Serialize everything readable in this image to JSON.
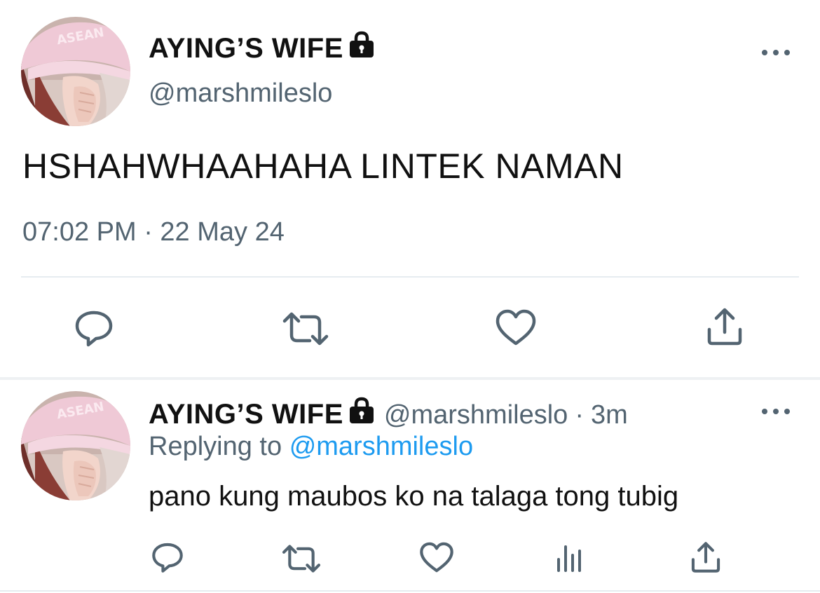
{
  "main_tweet": {
    "display_name": "AYING’S WIFE",
    "handle": "@marshmileslo",
    "text": "HSHAHWHAAHAHA LINTEK NAMAN",
    "timestamp": "07:02 PM · 22 May 24",
    "actions": [
      "reply-icon",
      "retweet-icon",
      "like-icon",
      "share-icon"
    ]
  },
  "reply_tweet": {
    "display_name": "AYING’S WIFE",
    "handle": "@marshmileslo",
    "separator": "·",
    "age": "3m",
    "replying_prefix": "Replying to",
    "replying_handle": "@marshmileslo",
    "text": "pano kung maubos ko na talaga tong tubig",
    "actions": [
      "reply-icon",
      "retweet-icon",
      "like-icon",
      "analytics-icon",
      "share-icon"
    ]
  },
  "colors": {
    "text": "#111111",
    "secondary": "#536471",
    "accent": "#1d9bf0",
    "divider": "#e6ecf0",
    "avatar_cap": "#efc9d6",
    "avatar_hair": "#7a3b34"
  }
}
